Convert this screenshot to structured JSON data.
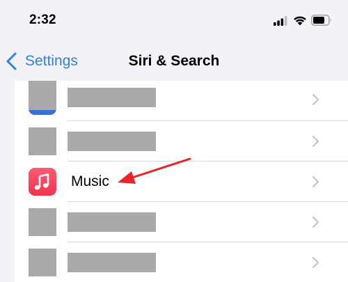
{
  "status_bar": {
    "time": "2:32",
    "icons": [
      "signal-icon",
      "wifi-icon",
      "battery-icon"
    ]
  },
  "nav": {
    "back_label": "Settings",
    "title": "Siri & Search"
  },
  "list": {
    "rows": [
      {
        "label": "",
        "icon": "app-icon",
        "redacted": true
      },
      {
        "label": "",
        "icon": "app-icon",
        "redacted": true
      },
      {
        "label": "Music",
        "icon": "music-app-icon",
        "redacted": false
      },
      {
        "label": "",
        "icon": "app-icon",
        "redacted": true
      },
      {
        "label": "",
        "icon": "app-icon",
        "redacted": true
      }
    ]
  },
  "annotation": {
    "type": "arrow",
    "color": "#e8262a",
    "points_to": "Music"
  },
  "colors": {
    "accent": "#2f80ed",
    "background": "#f2f2f7",
    "redaction": "#a9a9a9",
    "music_icon": "#f53a55"
  }
}
